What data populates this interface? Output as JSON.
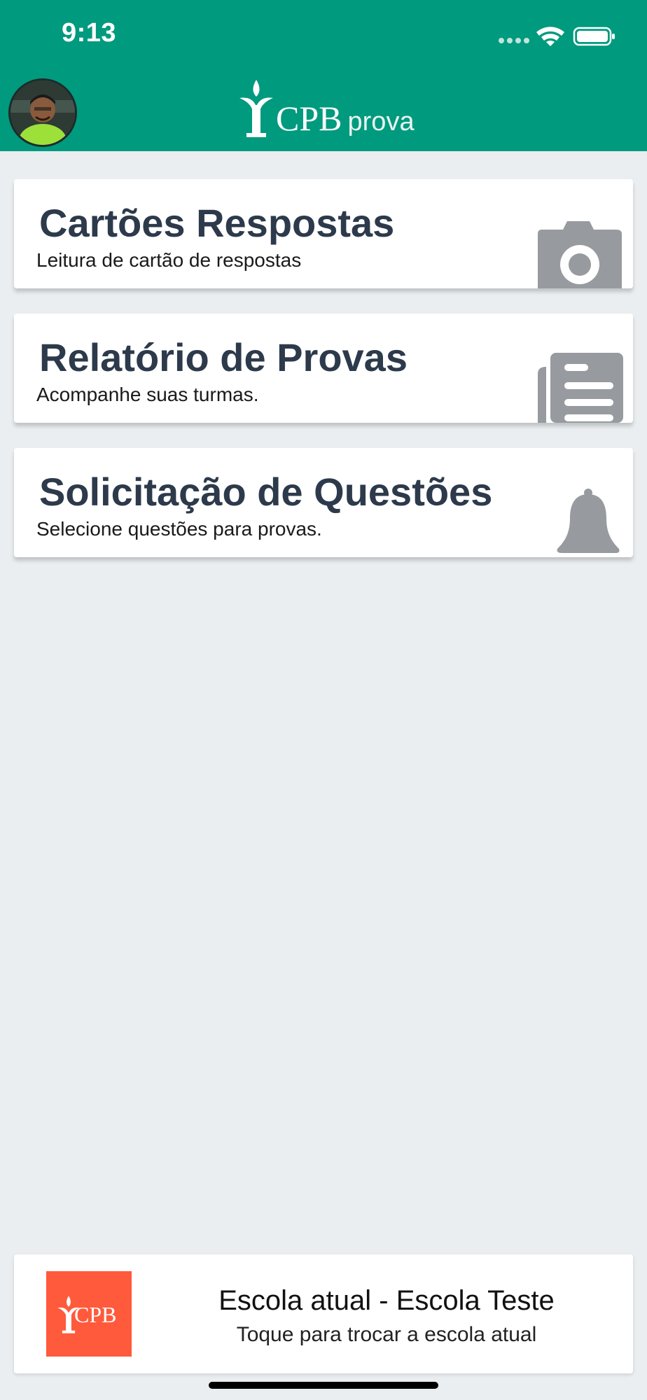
{
  "status_bar": {
    "time": "9:13"
  },
  "header": {
    "logo_text": "CPB",
    "logo_sub": "prova"
  },
  "cards": [
    {
      "title": "Cartões Respostas",
      "subtitle": "Leitura de cartão de respostas",
      "icon": "camera-icon"
    },
    {
      "title": "Relatório de Provas",
      "subtitle": "Acompanhe suas turmas.",
      "icon": "newspaper-icon"
    },
    {
      "title": "Solicitação de Questões",
      "subtitle": "Selecione questões para provas.",
      "icon": "bell-icon"
    }
  ],
  "school": {
    "logo_text": "CPB",
    "title": "Escola atual - Escola Teste",
    "subtitle": "Toque para trocar a escola atual"
  },
  "colors": {
    "header": "#009a7e",
    "background": "#eaeef0",
    "title": "#2c3a4b",
    "icon": "#979ba0",
    "school_logo": "#ff5a3c"
  }
}
